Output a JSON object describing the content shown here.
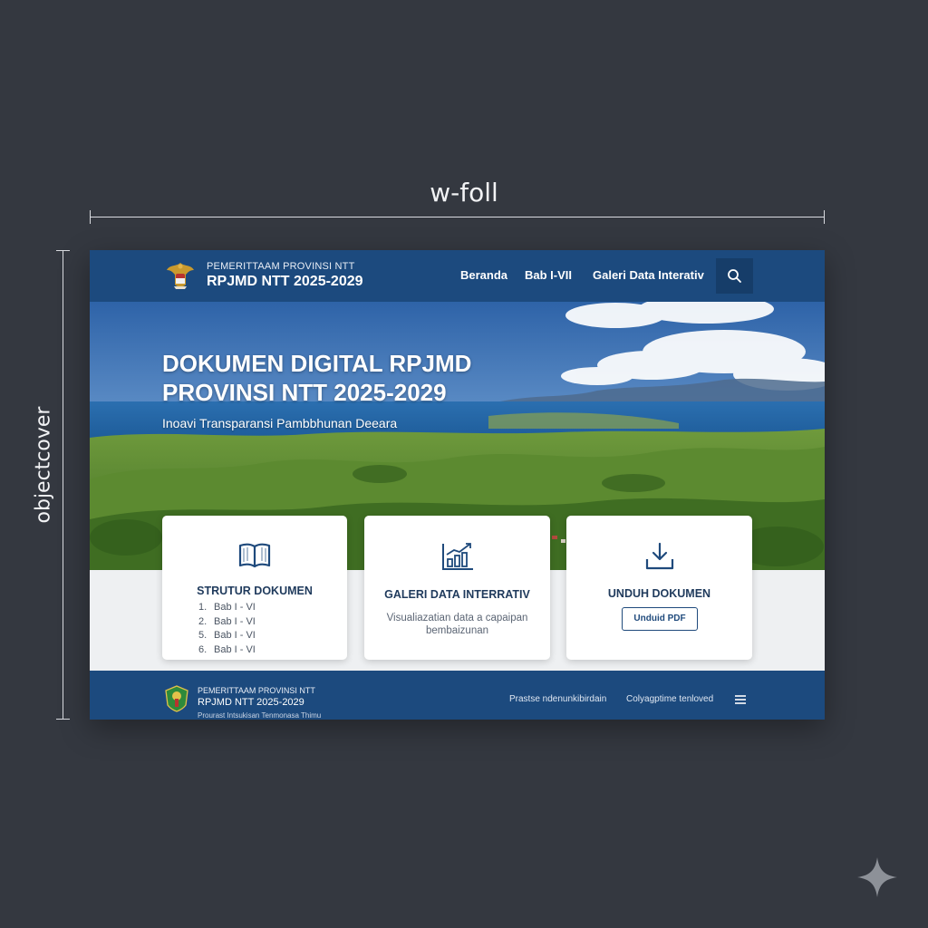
{
  "annotations": {
    "width_label": "w-foll",
    "height_label": "objectcover"
  },
  "header": {
    "org_name": "PEMERITTAAM PROVINSI NTT",
    "site_title": "RPJMD NTT 2025-2029",
    "nav": [
      "Beranda",
      "Bab I-VII",
      "Galeri Data Interativ"
    ],
    "search_icon": "search-icon"
  },
  "hero": {
    "title": "DOKUMEN DIGITAL RPJMD\nPROVINSI NTT 2025-2029",
    "subtitle": "Inoavi Transparansi Pambbhunan Deeara"
  },
  "cards": [
    {
      "icon": "book-icon",
      "title": "STRUTUR DOKUMEN",
      "items": [
        {
          "num": "1.",
          "text": "Bab I - VI"
        },
        {
          "num": "2.",
          "text": "Bab I - VI"
        },
        {
          "num": "5.",
          "text": "Bab I - VI"
        },
        {
          "num": "6.",
          "text": "Bab I - VI"
        }
      ]
    },
    {
      "icon": "chart-icon",
      "title": "GALERI DATA INTERRATIV",
      "description": "Visualiazatian data a capaipan bembaizunan"
    },
    {
      "icon": "download-icon",
      "title": "UNDUH DOKUMEN",
      "button_label": "Unduid PDF"
    }
  ],
  "footer": {
    "org_name": "PEMERITTAAM PROVINSI NTT",
    "site_title": "RPJMD NTT 2025-2029",
    "tagline": "Prourast Intsukisan Tenmonasa Thimu",
    "links": [
      "Prastse ndenunkibirdain",
      "Colyagptime tenloved"
    ],
    "menu_icon": "menu-icon"
  },
  "colors": {
    "background": "#343840",
    "primary": "#1c4a7e",
    "card_text": "#1f3a5c"
  }
}
